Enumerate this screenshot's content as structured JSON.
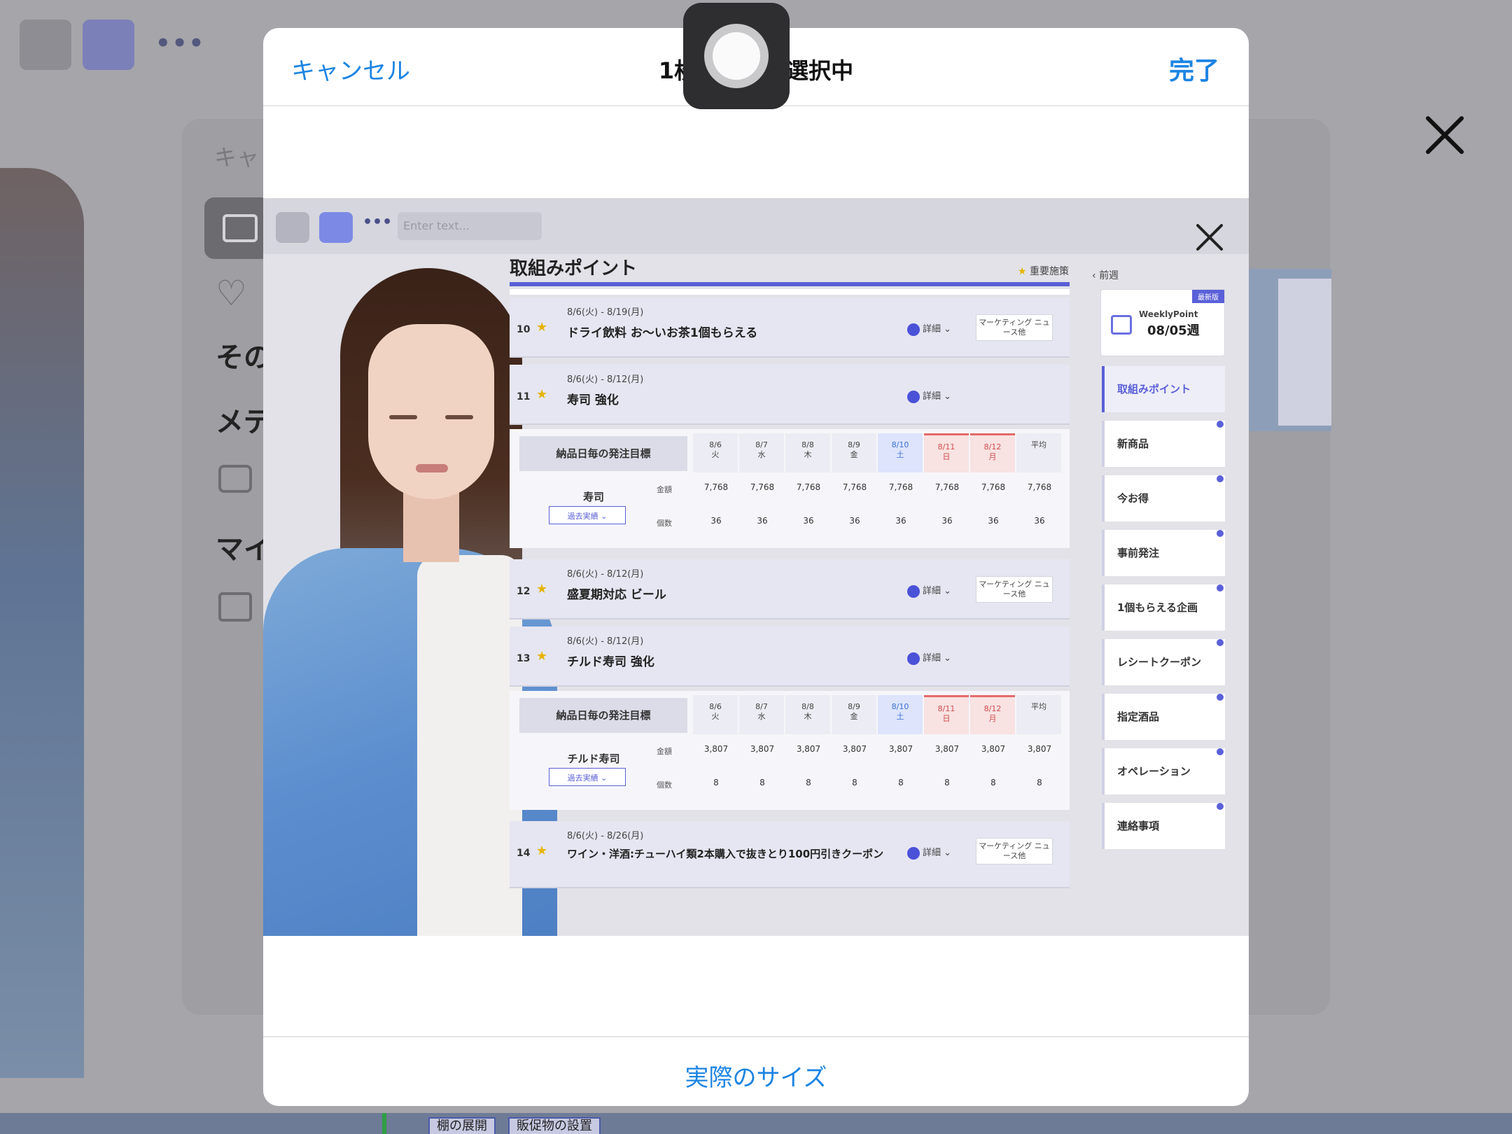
{
  "background": {
    "sidebar_labels": [
      "その",
      "メデ",
      "マイ"
    ],
    "sheet_cancel_label": "キャ",
    "bottom_chips": [
      "棚の展開",
      "販促物の設置"
    ]
  },
  "modal": {
    "title": "1枚の写真を選択中",
    "cancel_label": "キャンセル",
    "done_label": "完了",
    "actual_size_label": "実際のサイズ"
  },
  "preview": {
    "input_placeholder": "Enter text...",
    "dashboard_title": "取組みポイント",
    "legend_label": "重要施策",
    "items": [
      {
        "no": "10",
        "date": "8/6(火) - 8/19(月)",
        "name": "ドライ飲料 お～いお茶1個もらえる",
        "detail": "詳細",
        "tag": "マーケティング ニュース他"
      },
      {
        "no": "11",
        "date": "8/6(火) - 8/12(月)",
        "name": "寿司 強化",
        "detail": "詳細",
        "tag": ""
      },
      {
        "no": "12",
        "date": "8/6(火) - 8/12(月)",
        "name": "盛夏期対応 ビール",
        "detail": "詳細",
        "tag": "マーケティング ニュース他"
      },
      {
        "no": "13",
        "date": "8/6(火) - 8/12(月)",
        "name": "チルド寿司 強化",
        "detail": "詳細",
        "tag": ""
      },
      {
        "no": "14",
        "date": "8/6(火) - 8/26(月)",
        "name": "ワイン・洋酒:チューハイ類2本購入で抜きとり100円引きクーポン",
        "detail": "詳細",
        "tag": "マーケティング ニュース他"
      }
    ],
    "order_tables": [
      {
        "head": "納品日毎の発注目標",
        "product": "寿司",
        "select": "過去実績",
        "days": [
          [
            "8/6",
            "火"
          ],
          [
            "8/7",
            "水"
          ],
          [
            "8/8",
            "木"
          ],
          [
            "8/9",
            "金"
          ],
          [
            "8/10",
            "土"
          ],
          [
            "8/11",
            "日"
          ],
          [
            "8/12",
            "月"
          ],
          [
            "平均",
            ""
          ]
        ],
        "row1_label": "金額",
        "row1": [
          "7,768",
          "7,768",
          "7,768",
          "7,768",
          "7,768",
          "7,768",
          "7,768",
          "7,768"
        ],
        "row2_label": "個数",
        "row2": [
          "36",
          "36",
          "36",
          "36",
          "36",
          "36",
          "36",
          "36"
        ]
      },
      {
        "head": "納品日毎の発注目標",
        "product": "チルド寿司",
        "select": "過去実績",
        "days": [
          [
            "8/6",
            "火"
          ],
          [
            "8/7",
            "水"
          ],
          [
            "8/8",
            "木"
          ],
          [
            "8/9",
            "金"
          ],
          [
            "8/10",
            "土"
          ],
          [
            "8/11",
            "日"
          ],
          [
            "8/12",
            "月"
          ],
          [
            "平均",
            ""
          ]
        ],
        "row1_label": "金額",
        "row1": [
          "3,807",
          "3,807",
          "3,807",
          "3,807",
          "3,807",
          "3,807",
          "3,807",
          "3,807"
        ],
        "row2_label": "個数",
        "row2": [
          "8",
          "8",
          "8",
          "8",
          "8",
          "8",
          "8",
          "8"
        ]
      }
    ],
    "right_menu": {
      "back_label": "前週",
      "badge": "最新版",
      "weekly_label": "WeeklyPoint",
      "week": "08/05週",
      "items": [
        "取組みポイント",
        "新商品",
        "今お得",
        "事前発注",
        "1個もらえる企画",
        "レシートクーポン",
        "指定酒品",
        "オペレーション",
        "連絡事項"
      ]
    }
  }
}
